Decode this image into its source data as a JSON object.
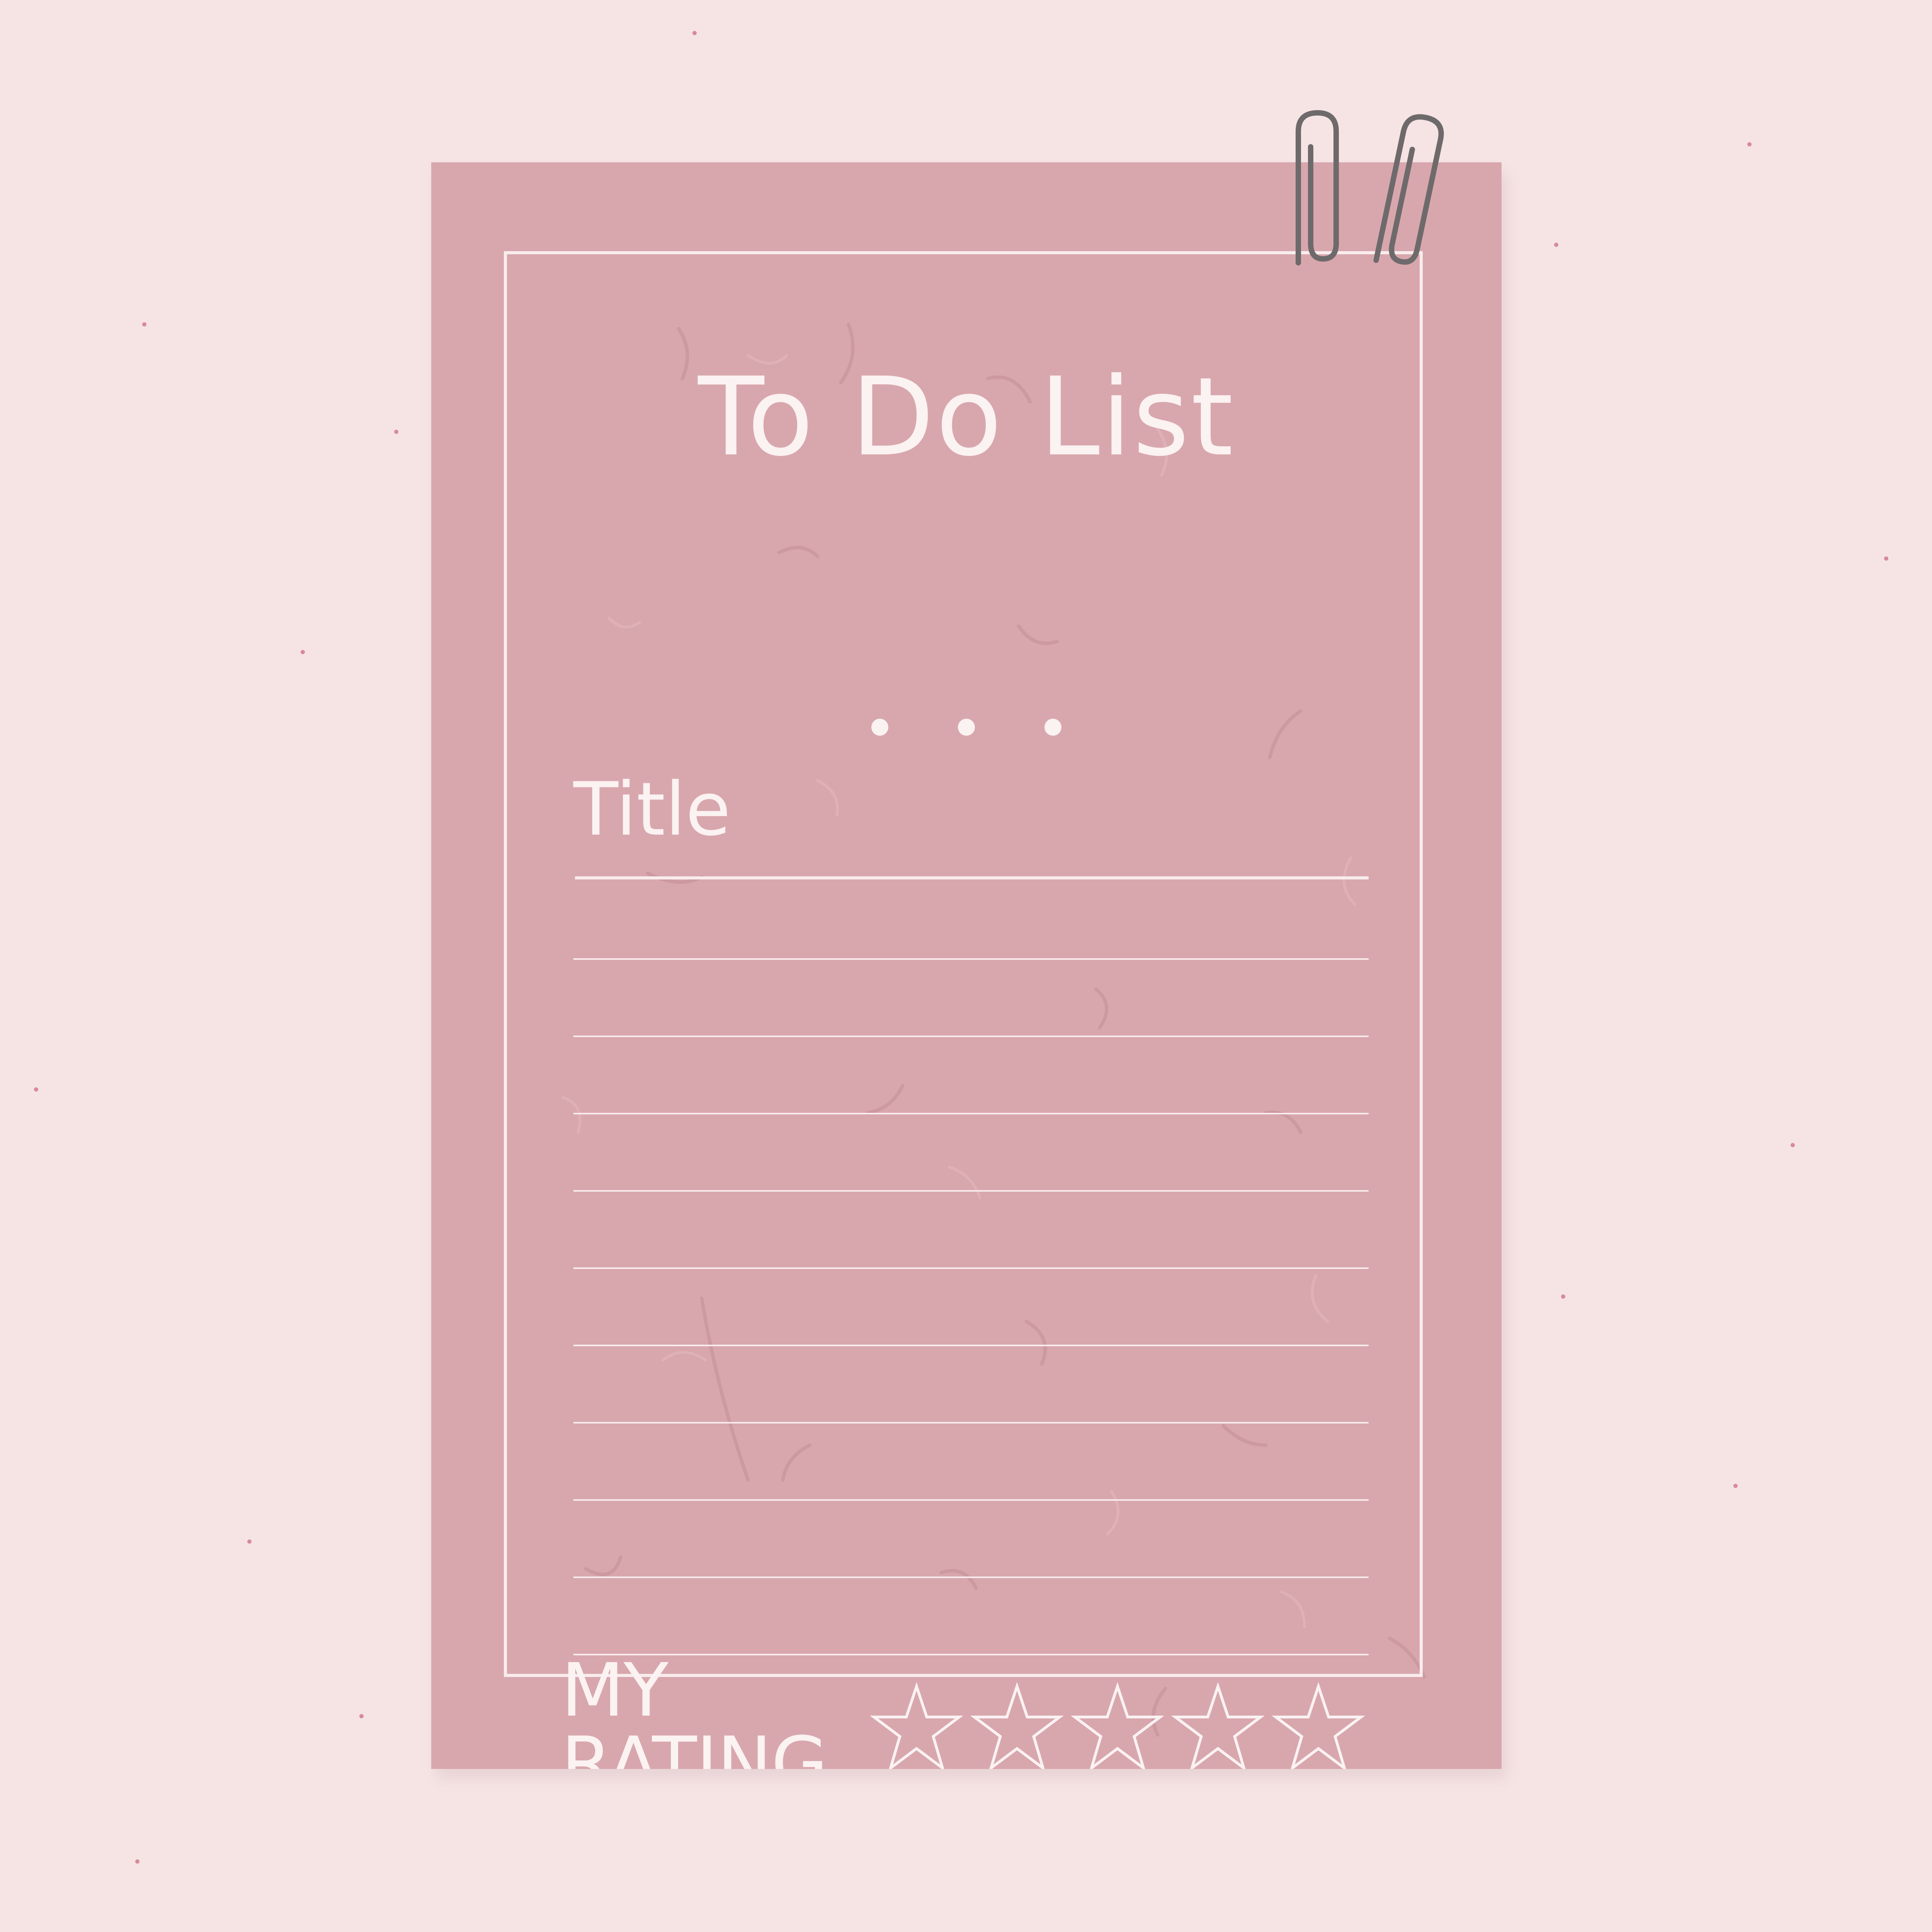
{
  "card": {
    "title": "To Do List",
    "title_field_label": "Title",
    "rating_label": "MY RATING",
    "line_count": 10
  },
  "rating": {
    "max": 5,
    "filled": 0
  },
  "colors": {
    "background": "#f6e4e5",
    "card": "#d8a7ad",
    "ink": "#fbf2f2",
    "clip": "#6e6a6b"
  },
  "icons": [
    "paperclip-icon",
    "star-icon"
  ]
}
